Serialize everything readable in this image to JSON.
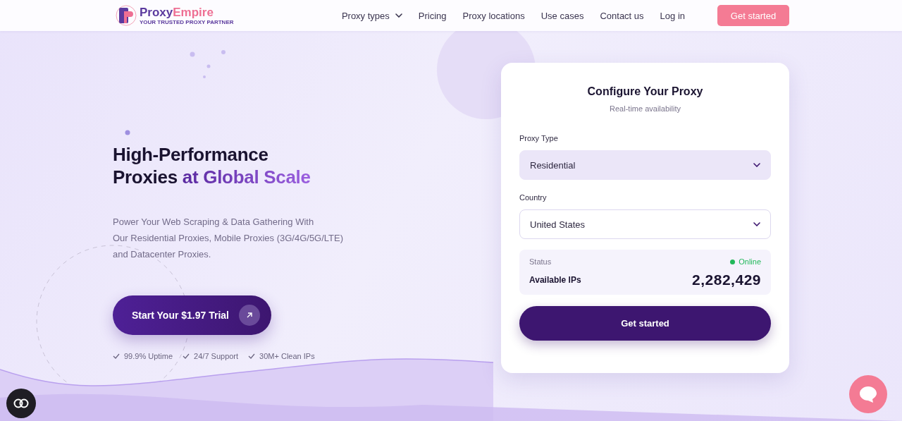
{
  "header": {
    "logo": {
      "name_1": "Proxy",
      "name_2": "Empire",
      "tagline": "YOUR TRUSTED PROXY PARTNER"
    },
    "nav": [
      {
        "label": "Proxy types",
        "dropdown": true
      },
      {
        "label": "Pricing",
        "dropdown": false
      },
      {
        "label": "Proxy locations",
        "dropdown": false
      },
      {
        "label": "Use cases",
        "dropdown": false
      },
      {
        "label": "Contact us",
        "dropdown": false
      },
      {
        "label": "Log in",
        "dropdown": false
      }
    ],
    "cta": "Get started"
  },
  "hero": {
    "headline_1": "High-Performance",
    "headline_2": "Proxies ",
    "headline_highlight": "at Global Scale",
    "description_lines": [
      "Power Your Web Scraping & Data Gathering With",
      "Our Residential Proxies, Mobile Proxies (3G/4G/5G/LTE)",
      "and Datacenter Proxies."
    ],
    "trial_button": "Start Your $1.97 Trial",
    "features": [
      "99.9% Uptime",
      "24/7 Support",
      "30M+ Clean IPs"
    ]
  },
  "config_card": {
    "title": "Configure Your Proxy",
    "subtitle": "Real-time availability",
    "fields": [
      {
        "label": "Proxy Type",
        "value": "Residential",
        "highlighted": true
      },
      {
        "label": "Country",
        "value": "United States",
        "highlighted": false
      }
    ],
    "status_label": "Status",
    "status_value": "Online",
    "status_online": true,
    "ips_label": "Available IPs",
    "ips_value": "2,282,429",
    "button": "Get started"
  }
}
